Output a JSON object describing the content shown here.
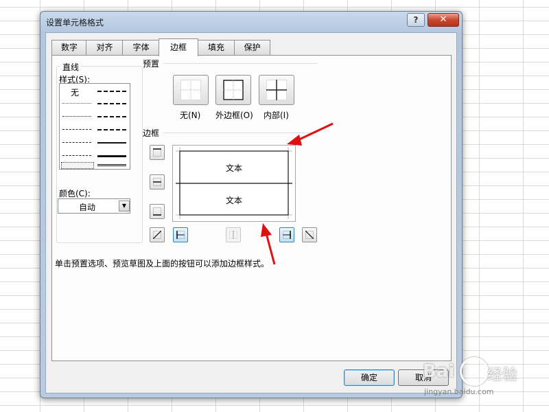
{
  "dialog": {
    "title": "设置单元格格式",
    "help_label": "?",
    "close_label": "✕"
  },
  "tabs": [
    {
      "label": "数字",
      "active": false
    },
    {
      "label": "对齐",
      "active": false
    },
    {
      "label": "字体",
      "active": false
    },
    {
      "label": "边框",
      "active": true
    },
    {
      "label": "填充",
      "active": false
    },
    {
      "label": "保护",
      "active": false
    }
  ],
  "line_group": {
    "title": "直线",
    "style_label": "样式(S):",
    "none_label": "无",
    "color_label": "颜色(C):",
    "color_value": "自动"
  },
  "preset_group": {
    "title": "预置",
    "buttons": [
      {
        "label": "无(N)",
        "icon": "preset-none-icon"
      },
      {
        "label": "外边框(O)",
        "icon": "preset-outline-icon"
      },
      {
        "label": "内部(I)",
        "icon": "preset-inside-icon"
      }
    ]
  },
  "border_group": {
    "title": "边框",
    "preview_text_top": "文本",
    "preview_text_bottom": "文本"
  },
  "hint": "单击预置选项、预览草图及上面的按钮可以添加边框样式。",
  "footer": {
    "ok_label": "确定",
    "cancel_label": "取消"
  },
  "watermark": {
    "brand": "Bai",
    "brand2": "经验",
    "url": "jingyan.baidu.com"
  },
  "colors": {
    "arrow": "#e01010",
    "active_border_button": "#3c7fb1"
  }
}
